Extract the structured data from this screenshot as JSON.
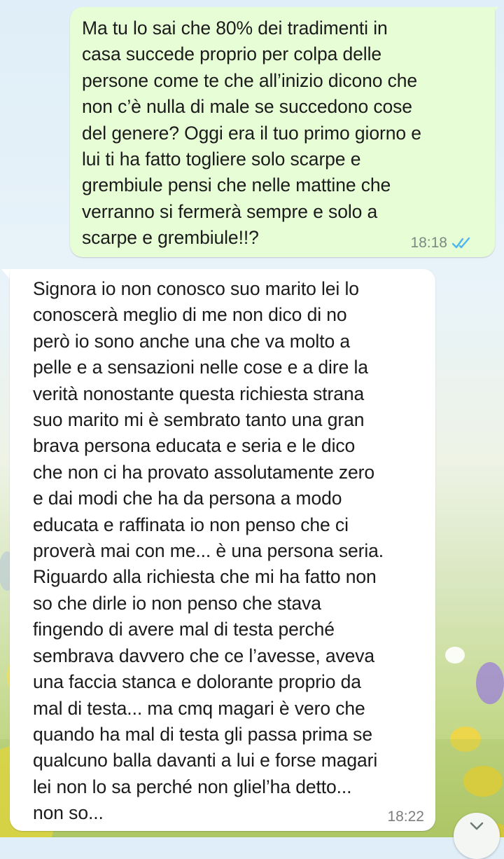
{
  "chat": {
    "messages": [
      {
        "direction": "outgoing",
        "text": "Ma tu lo sai che 80% dei tradimenti in\ncasa succede proprio per colpa delle\npersone come te che all’inizio dicono che\nnon c’è nulla di male se succedono cose\ndel genere? Oggi era il tuo primo giorno e\nlui ti ha fatto togliere solo scarpe e\ngrembiule pensi che nelle mattine che\nverranno si fermerà sempre e solo a\nscarpe e grembiule!!?",
        "time": "18:18",
        "status": "read"
      },
      {
        "direction": "incoming",
        "text": "Signora io non conosco suo marito lei lo\nconoscerà meglio di me non dico di no\nperò io sono anche una che va molto a\npelle e a sensazioni nelle cose e a dire la\nverità nonostante questa richiesta strana\nsuo marito mi è sembrato tanto una gran\nbrava persona educata e seria e le dico\nche non ci ha provato assolutamente zero\ne dai modi che ha da persona a modo\neducata e raffinata io non penso che ci\nproverà mai con me... è una persona seria.\nRiguardo alla richiesta che mi ha fatto non\nso che dirle io non penso che stava\nfingendo di avere mal di testa perché\nsembrava davvero che ce l’avesse, aveva\nuna faccia stanca e dolorante proprio da\nmal di testa... ma cmq magari è vero che\nquando ha mal di testa gli passa prima se\nqualcuno balla davanti a lui e forse magari\nlei non lo sa perché non gliel’ha detto...\nnon so...",
        "time": "18:22"
      }
    ],
    "scroll_button_icon": "chevron-down-icon",
    "read_ticks_icon": "double-check-icon",
    "colors": {
      "outgoing_bubble": "#e7fdd6",
      "incoming_bubble": "#ffffff",
      "read_ticks": "#4fb6ec"
    }
  }
}
